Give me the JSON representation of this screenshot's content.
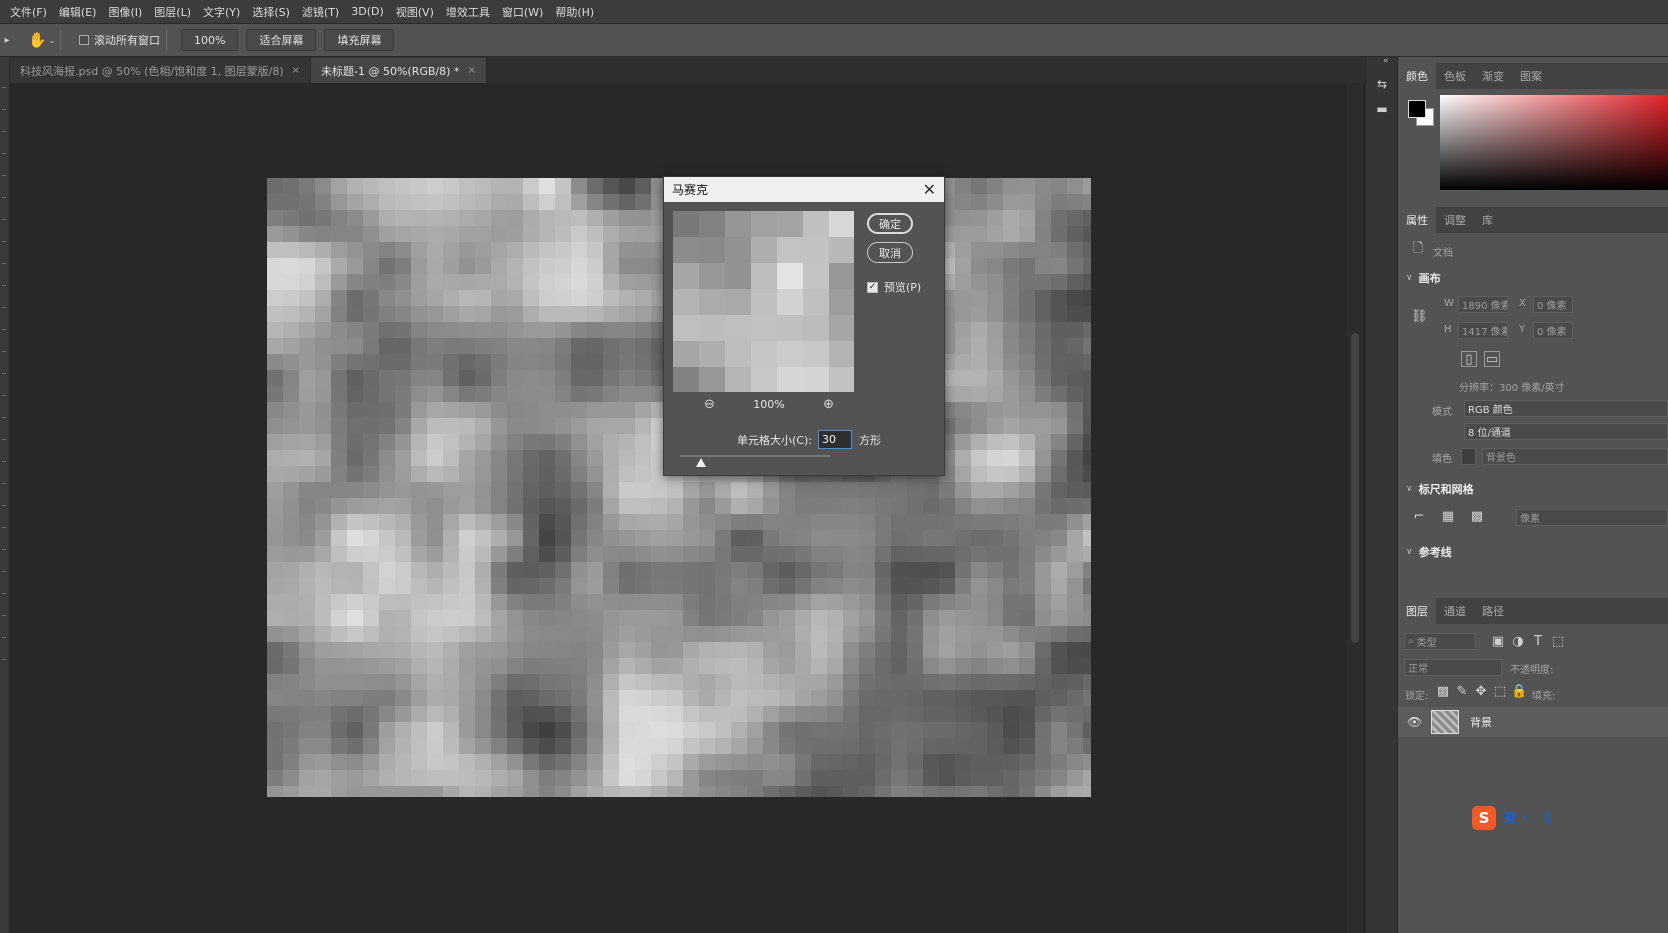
{
  "menubar": {
    "items": [
      "文件(F)",
      "编辑(E)",
      "图像(I)",
      "图层(L)",
      "文字(Y)",
      "选择(S)",
      "滤镜(T)",
      "3D(D)",
      "视图(V)",
      "增效工具",
      "窗口(W)",
      "帮助(H)"
    ]
  },
  "options": {
    "hand_icon": "hand-icon",
    "scroll_all_label": "滚动所有窗口",
    "zoom_button": "100%",
    "fit_screen_button": "适合屏幕",
    "fill_screen_button": "填充屏幕"
  },
  "tabs": [
    {
      "label": "科技风海报.psd @ 50% (色相/饱和度 1, 图层蒙版/8)",
      "close": "×"
    },
    {
      "label": "未标题-1 @ 50%(RGB/8) *",
      "close": "×"
    }
  ],
  "dialog": {
    "title": "马赛克",
    "close_symbol": "✕",
    "ok_label": "确定",
    "cancel_label": "取消",
    "preview_label": "预览(P)",
    "preview_checked": true,
    "zoom_value": "100%",
    "cell_size_label": "单元格大小(C):",
    "cell_size_value": "30",
    "cell_size_unit": "方形"
  },
  "color_panel": {
    "tabs": [
      "颜色",
      "色板",
      "渐变",
      "图案"
    ],
    "foreground": "#000000",
    "background": "#ffffff",
    "hue_color": "#e3232b"
  },
  "properties": {
    "tabs": [
      "属性",
      "调整",
      "库"
    ],
    "doc_label": "文档",
    "canvas_title": "画布",
    "w_label": "W",
    "w_value": "1890 像素",
    "x_label": "X",
    "x_value": "0 像素",
    "h_label": "H",
    "h_value": "1417 像素",
    "y_label": "Y",
    "y_value": "0 像素",
    "resolution_text": "分辨率：300 像素/英寸",
    "mode_label": "模式",
    "mode_value": "RGB 颜色",
    "depth_value": "8 位/通道",
    "fill_label": "填色",
    "fill_value": "背景色",
    "rulers_title": "标尺和网格",
    "units_value": "像素",
    "guides_title": "参考线"
  },
  "layers": {
    "tabs": [
      "图层",
      "通道",
      "路径"
    ],
    "search_placeholder": "类型",
    "blend_mode": "正常",
    "opacity_label": "不透明度:",
    "lock_label": "锁定:",
    "fill_label": "填充:",
    "layer_name": "背景"
  },
  "ime": {
    "logo": "S",
    "mode": "英",
    "punct": "•,"
  }
}
